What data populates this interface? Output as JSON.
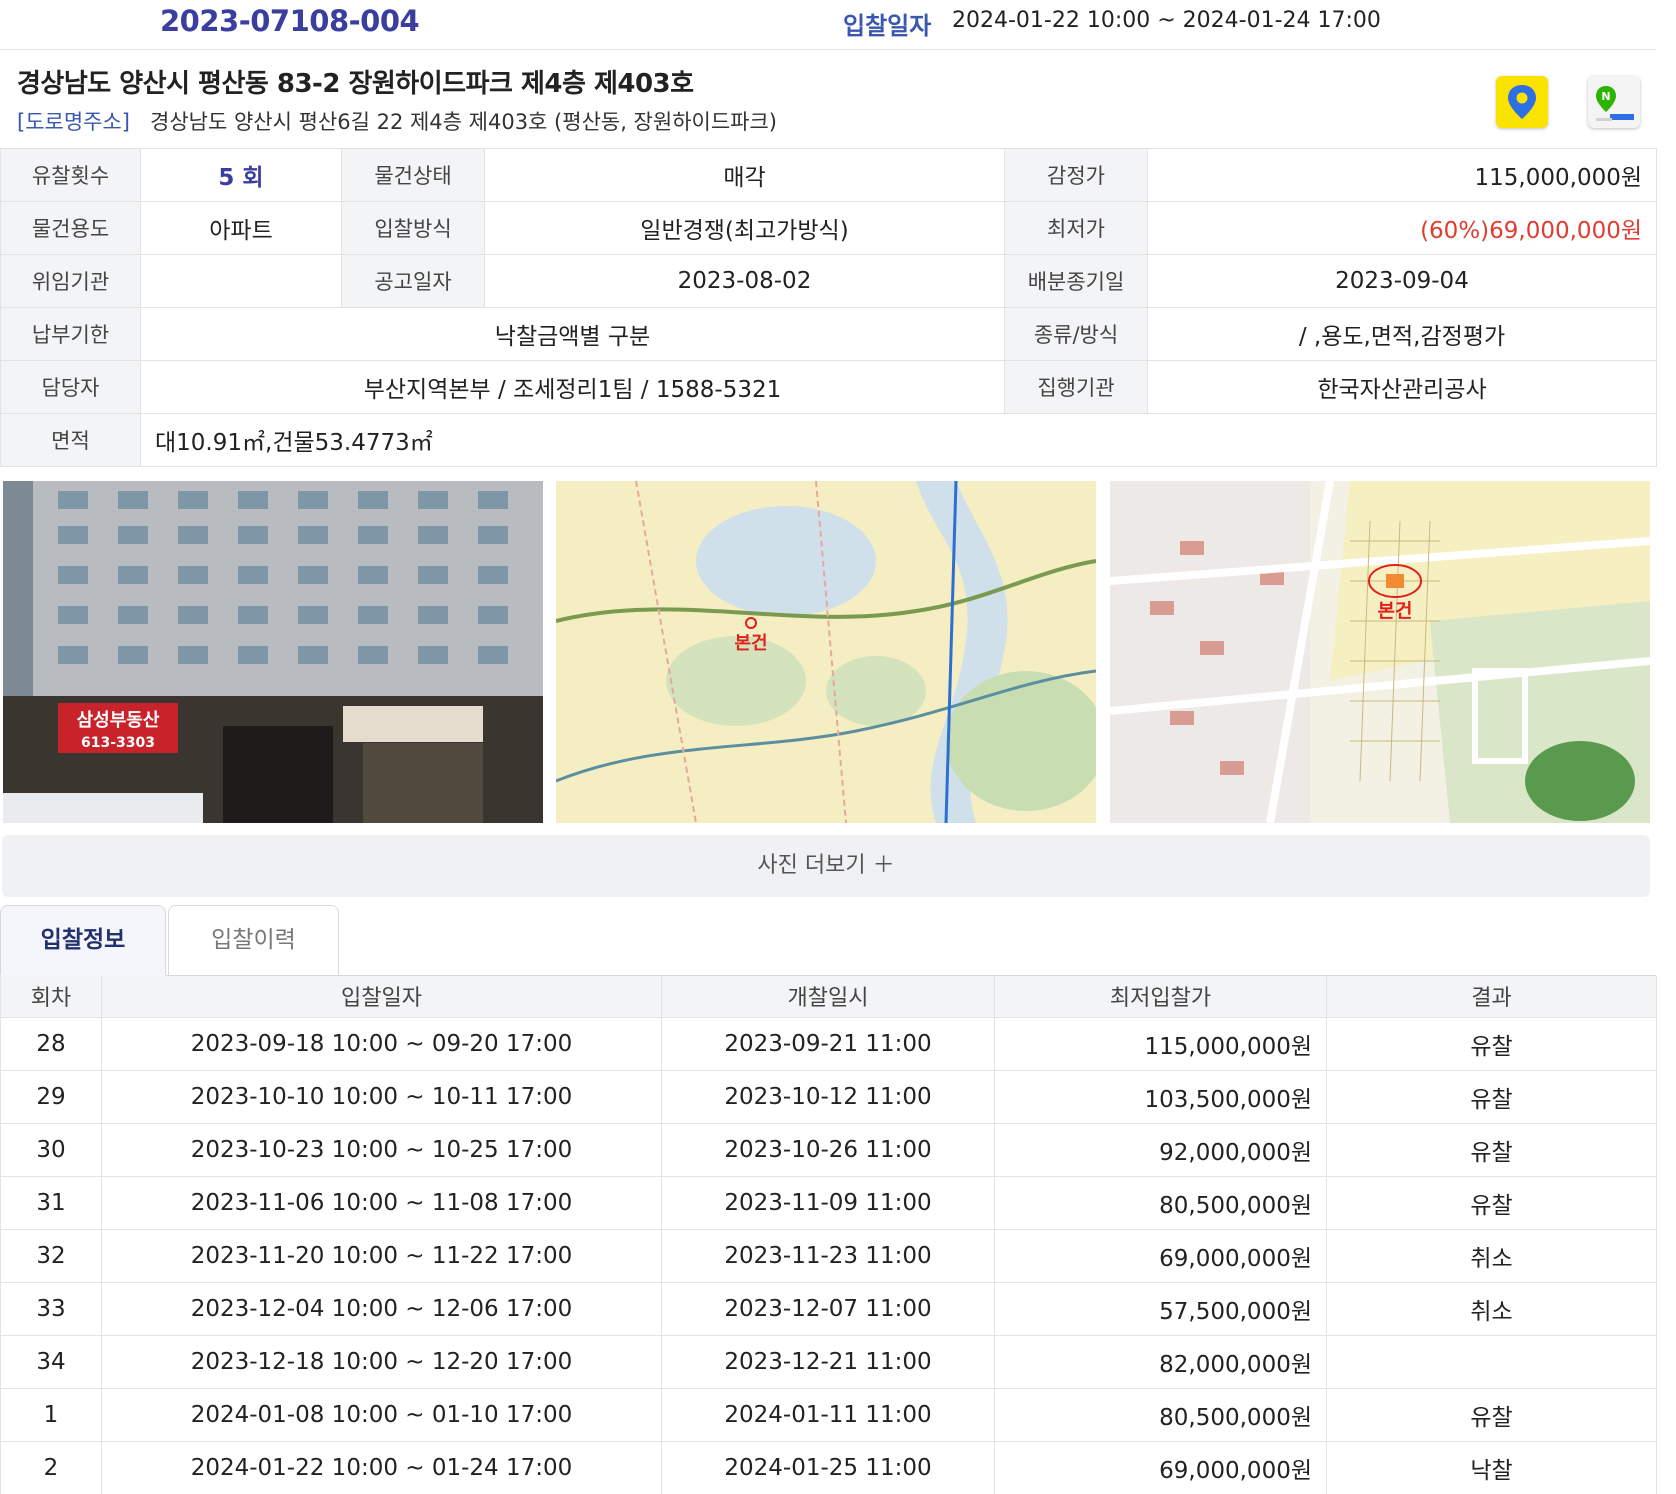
{
  "header": {
    "case_number": "2023-07108-004",
    "bid_date_label": "입찰일자",
    "bid_date_value": "2024-01-22 10:00 ~ 2024-01-24 17:00"
  },
  "address": {
    "title": "경상남도 양산시 평산동 83-2 장원하이드파크 제4층 제403호",
    "road_tag": "[도로명주소]",
    "road_address": "경상남도 양산시 평산6길 22 제4층 제403호 (평산동, 장원하이드파크)"
  },
  "info": {
    "fail_count_label": "유찰횟수",
    "fail_count": "5 회",
    "status_label": "물건상태",
    "status": "매각",
    "appraisal_label": "감정가",
    "appraisal": "115,000,000원",
    "usage_label": "물건용도",
    "usage": "아파트",
    "bid_method_label": "입찰방식",
    "bid_method": "일반경쟁(최고가방식)",
    "min_price_label": "최저가",
    "min_price": "(60%)69,000,000원",
    "agency_label": "위임기관",
    "agency": "",
    "notice_date_label": "공고일자",
    "notice_date": "2023-08-02",
    "dist_deadline_label": "배분종기일",
    "dist_deadline": "2023-09-04",
    "pay_deadline_label": "납부기한",
    "pay_deadline": "낙찰금액별 구분",
    "type_method_label": "종류/방식",
    "type_method": "/ ,용도,면적,감정평가",
    "manager_label": "담당자",
    "manager": "부산지역본부 / 조세정리1팀 / 1588-5321",
    "exec_org_label": "집행기관",
    "exec_org": "한국자산관리공사",
    "area_label": "면적",
    "area": "대10.91㎡,건물53.4773㎡"
  },
  "photos": {
    "map_marker_label": "본건",
    "sign_shop": "삼성부동산",
    "sign_phone": "613-3303"
  },
  "more_photos_label": "사진 더보기 ＋",
  "tabs": [
    {
      "label": "입찰정보"
    },
    {
      "label": "입찰이력"
    }
  ],
  "bid_table": {
    "headers": [
      "회차",
      "입찰일자",
      "개찰일시",
      "최저입찰가",
      "결과"
    ],
    "rows": [
      {
        "round": "28",
        "bid_period": "2023-09-18 10:00 ~ 09-20 17:00",
        "open_date": "2023-09-21 11:00",
        "min_bid": "115,000,000원",
        "result": "유찰"
      },
      {
        "round": "29",
        "bid_period": "2023-10-10 10:00 ~ 10-11 17:00",
        "open_date": "2023-10-12 11:00",
        "min_bid": "103,500,000원",
        "result": "유찰"
      },
      {
        "round": "30",
        "bid_period": "2023-10-23 10:00 ~ 10-25 17:00",
        "open_date": "2023-10-26 11:00",
        "min_bid": "92,000,000원",
        "result": "유찰"
      },
      {
        "round": "31",
        "bid_period": "2023-11-06 10:00 ~ 11-08 17:00",
        "open_date": "2023-11-09 11:00",
        "min_bid": "80,500,000원",
        "result": "유찰"
      },
      {
        "round": "32",
        "bid_period": "2023-11-20 10:00 ~ 11-22 17:00",
        "open_date": "2023-11-23 11:00",
        "min_bid": "69,000,000원",
        "result": "취소"
      },
      {
        "round": "33",
        "bid_period": "2023-12-04 10:00 ~ 12-06 17:00",
        "open_date": "2023-12-07 11:00",
        "min_bid": "57,500,000원",
        "result": "취소"
      },
      {
        "round": "34",
        "bid_period": "2023-12-18 10:00 ~ 12-20 17:00",
        "open_date": "2023-12-21 11:00",
        "min_bid": "82,000,000원",
        "result": ""
      },
      {
        "round": "1",
        "bid_period": "2024-01-08 10:00 ~ 01-10 17:00",
        "open_date": "2024-01-11 11:00",
        "min_bid": "80,500,000원",
        "result": "유찰"
      },
      {
        "round": "2",
        "bid_period": "2024-01-22 10:00 ~ 01-24 17:00",
        "open_date": "2024-01-25 11:00",
        "min_bid": "69,000,000원",
        "result": "낙찰"
      }
    ]
  },
  "colors": {
    "accent": "#3a3e9e",
    "link_blue": "#3a57b0",
    "price_red": "#e03c31",
    "label_bg": "#f3f4f6"
  },
  "icons": [
    "kakao-map-icon",
    "naver-map-icon"
  ]
}
